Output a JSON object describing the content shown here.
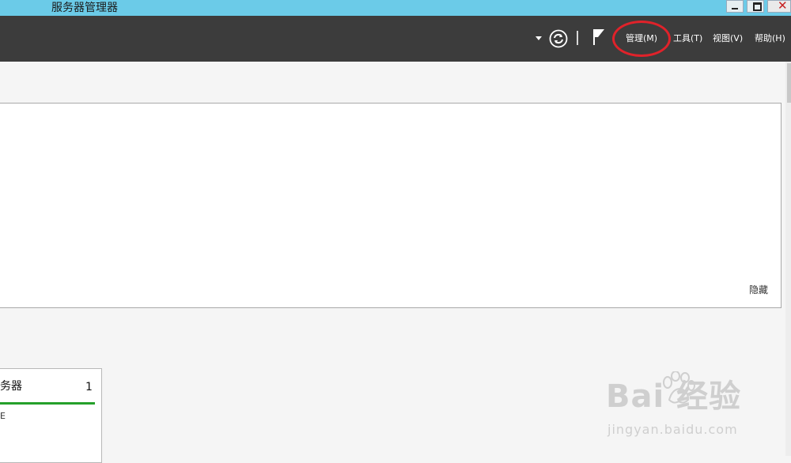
{
  "window": {
    "title": "服务器管理器"
  },
  "toolbar": {
    "menus": [
      {
        "label": "管理(M)"
      },
      {
        "label": "工具(T)"
      },
      {
        "label": "视图(V)"
      },
      {
        "label": "帮助(H)"
      }
    ]
  },
  "panel": {
    "hide_label": "隐藏"
  },
  "tile": {
    "title": "务器",
    "count": "1",
    "subtitle": "E"
  },
  "watermark": {
    "logo": "Bai  经验",
    "url": "jingyan.baidu.com"
  },
  "colors": {
    "titlebar": "#6bcbe8",
    "toolbar": "#3c3c3c",
    "highlight_ring": "#e0222a",
    "status_bar": "#25a02a"
  }
}
